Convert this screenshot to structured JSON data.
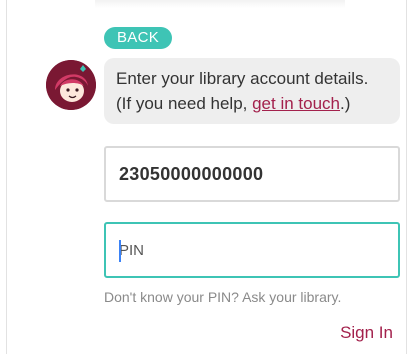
{
  "back_button": {
    "label": "BACK"
  },
  "message": {
    "text_before": "Enter your library account details. (If you need help, ",
    "link_text": "get in touch",
    "text_after": ".)"
  },
  "card_field": {
    "value": "23050000000000"
  },
  "pin_field": {
    "placeholder": "PIN",
    "value": ""
  },
  "help_text": "Don't know your PIN? Ask your library.",
  "sign_in_button": {
    "label": "Sign In"
  },
  "colors": {
    "accent": "#3ec4b5",
    "brand": "#a3214c",
    "avatar_bg": "#7a1833"
  },
  "icons": {
    "avatar": "libby-avatar-icon"
  }
}
